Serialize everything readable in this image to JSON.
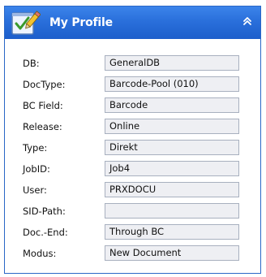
{
  "panel": {
    "title": "My Profile",
    "header_icon": "document-checkmark-pencil-icon",
    "collapse_icon": "double-chevron-up-icon",
    "colors": {
      "header_blue": "#2a6fdb",
      "border_blue": "#2a67c7",
      "field_background": "#eeeff3",
      "field_border": "#a8b0bf"
    }
  },
  "fields": [
    {
      "label": "DB:",
      "value": "GeneralDB"
    },
    {
      "label": "DocType:",
      "value": "Barcode-Pool (010)"
    },
    {
      "label": "BC Field:",
      "value": "Barcode"
    },
    {
      "label": "Release:",
      "value": "Online"
    },
    {
      "label": "Type:",
      "value": "Direkt"
    },
    {
      "label": "JobID:",
      "value": "Job4"
    },
    {
      "label": "User:",
      "value": "PRXDOCU"
    },
    {
      "label": "SID-Path:",
      "value": ""
    },
    {
      "label": "Doc.-End:",
      "value": "Through BC"
    },
    {
      "label": "Modus:",
      "value": "New Document"
    }
  ]
}
